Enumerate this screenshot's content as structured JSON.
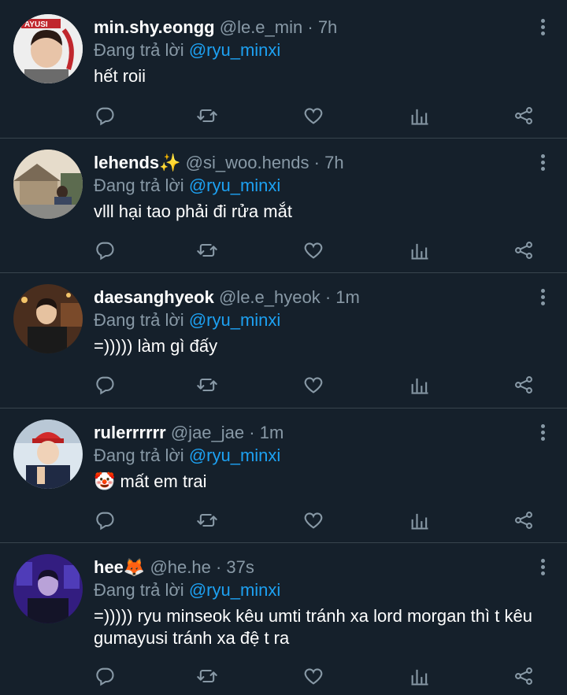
{
  "colors": {
    "background": "#15202b",
    "secondary": "#8899a6",
    "accent": "#1da1f2",
    "divider": "#38444d"
  },
  "tweets": [
    {
      "name": "min.shy.eongg",
      "handle": "@le.e_min",
      "dot": "·",
      "time": "7h",
      "replying_prefix": "Đang trả lời",
      "replying_to": "@ryu_minxi",
      "text": "hết roii",
      "avatar_badge": "AYUSI"
    },
    {
      "name": "lehends✨",
      "handle": "@si_woo.hends",
      "dot": "·",
      "time": "7h",
      "replying_prefix": "Đang trả lời",
      "replying_to": "@ryu_minxi",
      "text": "vlll hại tao phải đi rửa mắt"
    },
    {
      "name": "daesanghyeok",
      "handle": "@le.e_hyeok",
      "dot": "·",
      "time": "1m",
      "replying_prefix": "Đang trả lời",
      "replying_to": "@ryu_minxi",
      "text": "=))))) làm gì đấy"
    },
    {
      "name": "rulerrrrrr",
      "handle": "@jae_jae",
      "dot": "·",
      "time": "1m",
      "replying_prefix": "Đang trả lời",
      "replying_to": "@ryu_minxi",
      "text": "🤡 mất em trai"
    },
    {
      "name": "hee🦊",
      "handle": "@he.he",
      "dot": "·",
      "time": "37s",
      "replying_prefix": "Đang trả lời",
      "replying_to": "@ryu_minxi",
      "text": "=))))) ryu minseok kêu umti tránh xa lord morgan thì t kêu gumayusi tránh xa đệ t ra"
    }
  ],
  "icons": [
    "reply-icon",
    "retweet-icon",
    "like-icon",
    "analytics-icon",
    "share-icon",
    "more-icon"
  ]
}
